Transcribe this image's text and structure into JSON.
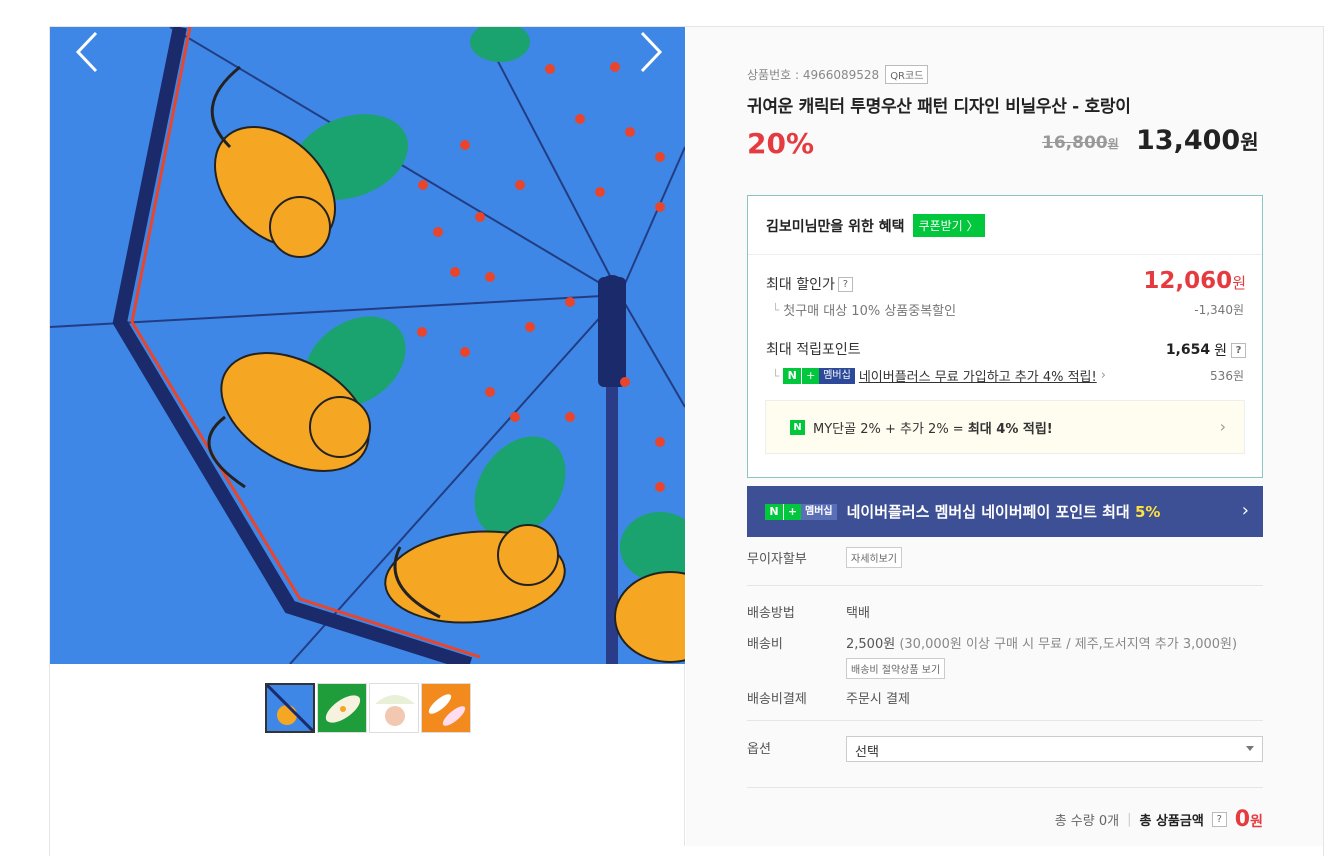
{
  "header": {
    "links": ""
  },
  "gallery": {
    "prev_icon": "chevron-left-icon",
    "next_icon": "chevron-right-icon",
    "thumbnails": [
      "thumb-1",
      "thumb-2",
      "thumb-3",
      "thumb-4"
    ]
  },
  "product": {
    "number_label": "상품번호 : 4966089528",
    "qr_label": "QR코드",
    "title": "귀여운 캐릭터 투명우산 패턴 디자인 비닐우산 - 호랑이",
    "discount_pct": "20%",
    "original_price": "16,800",
    "original_unit": "원",
    "sale_price": "13,400",
    "sale_unit": "원"
  },
  "benefit": {
    "heading": "김보미님만을 위한 혜택",
    "coupon_btn": "쿠폰받기 〉",
    "max_discount_label": "최대 할인가",
    "max_discount_value": "12,060",
    "max_discount_unit": "원",
    "first_purchase_label": "첫구매 대상 10% 상품중복할인",
    "first_purchase_value": "-1,340원",
    "max_points_label": "최대 적립포인트",
    "max_points_value": "1,654",
    "max_points_unit": "원",
    "plus_badge_n": "N",
    "plus_badge_plus": "+",
    "plus_badge_m": "멤버십",
    "plus_link": "네이버플러스 무료 가입하고 추가 4% 적립!",
    "plus_points_value": "536원",
    "my_text_a": "MY단골 2% + 추가 2% = ",
    "my_text_b": "최대 4% 적립!",
    "question": "?"
  },
  "banner": {
    "badge_n": "N",
    "badge_plus": "+",
    "badge_m": "멤버십",
    "text": "네이버플러스 멤버십 네이버페이 포인트 최대",
    "highlight": "5%"
  },
  "info": {
    "installment_label": "무이자할부",
    "installment_btn": "자세히보기",
    "ship_method_label": "배송방법",
    "ship_method_value": "택배",
    "ship_fee_label": "배송비",
    "ship_fee_value": "2,500원",
    "ship_fee_note": "(30,000원 이상 구매 시 무료 / 제주,도서지역 추가 3,000원)",
    "ship_fee_btn": "배송비 절약상품 보기",
    "ship_pay_label": "배송비결제",
    "ship_pay_value": "주문시 결제",
    "option_label": "옵션",
    "option_selected": "선택"
  },
  "total": {
    "qty": "총 수량 0개",
    "sum_label": "총 상품금액",
    "sum_value": "0",
    "sum_unit": "원"
  },
  "colors": {
    "sky": "#3f87e6",
    "tiger": "#f5a623",
    "leaf": "#1aa36f",
    "red": "#e53a40",
    "green": "#00c73c",
    "navy": "#3d5095"
  }
}
